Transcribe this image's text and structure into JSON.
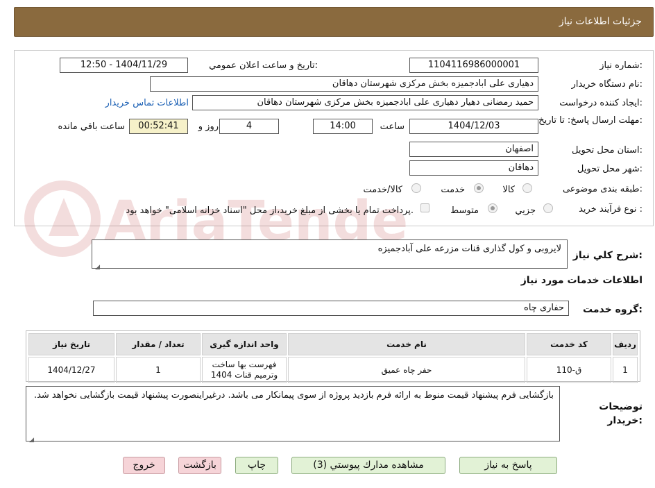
{
  "header": {
    "title": "جزئيات اطلاعات نياز"
  },
  "form": {
    "need_number": {
      "label": "شماره نياز:",
      "value": "1104116986000001"
    },
    "announce_datetime": {
      "label": "تاريخ و ساعت اعلان عمومي:",
      "value": "1404/11/29 - 12:50"
    },
    "buyer_org": {
      "label": "نام دستگاه خريدار:",
      "value": "دهیاری علی ابادجمیزه بخش مرکزی شهرستان دهاقان"
    },
    "requester": {
      "label": "ايجاد كننده درخواست:",
      "value": "حمید رمضانی دهیار دهیاری علی ابادجمیزه بخش مرکزی شهرستان دهاقان",
      "contact_link": "اطلاعات تماس خريدار"
    },
    "deadline": {
      "label": "مهلت ارسال پاسخ: تا تاريخ:",
      "date": "1404/12/03",
      "time_label": "ساعت",
      "time": "14:00",
      "days": "4",
      "days_label": "روز و",
      "remaining": "00:52:41",
      "remaining_label": "ساعت باقي مانده"
    },
    "province": {
      "label": "استان محل تحويل:",
      "value": "اصفهان"
    },
    "city": {
      "label": "شهر محل تحويل:",
      "value": "دهاقان"
    },
    "category": {
      "label": "طبقه بندی موضوعی:",
      "options": [
        "كالا",
        "خدمت",
        "كالا/خدمت"
      ],
      "selected": "خدمت"
    },
    "process": {
      "label": "نوع فرآيند خريد :",
      "options": [
        "جزيي",
        "متوسط"
      ],
      "selected": "جزيي",
      "note": "پرداخت تمام یا بخشی از مبلغ خرید،از محل \"اسناد خزانه اسلامی\" خواهد بود."
    }
  },
  "watermark": "AriaTender.neT",
  "summary": {
    "label": "شرح كلي نياز:",
    "value": "لایروبی و کول گذاری قنات مزرعه علی آبادجمیزه"
  },
  "services_title": "اطلاعات خدمات مورد نياز",
  "service_group": {
    "label": "گروه خدمت:",
    "value": "حفاری چاه"
  },
  "table": {
    "headers": [
      "رديف",
      "كد خدمت",
      "نام خدمت",
      "واحد اندازه گيری",
      "تعداد / مقدار",
      "تاريخ نياز"
    ],
    "rows": [
      {
        "row": "1",
        "code": "ق-110",
        "name": "حفر چاه عمیق",
        "unit": "فهرست بها ساخت وترمیم قنات 1404",
        "qty": "1",
        "date": "1404/12/27"
      }
    ]
  },
  "buyer_notes": {
    "label": "توضيحات خريدار:",
    "value": "بازگشایی فرم پیشنهاد قیمت منوط به ارائه فرم بازدید پروژه از سوی پیمانکار می باشد. درغیراینصورت پیشنهاد قیمت بازگشایی نخواهد شد."
  },
  "buttons": {
    "reply": "پاسخ به نياز",
    "attachments": "مشاهده مدارك پيوستي (3)",
    "print": "چاپ",
    "back": "بازگشت",
    "exit": "خروج"
  }
}
